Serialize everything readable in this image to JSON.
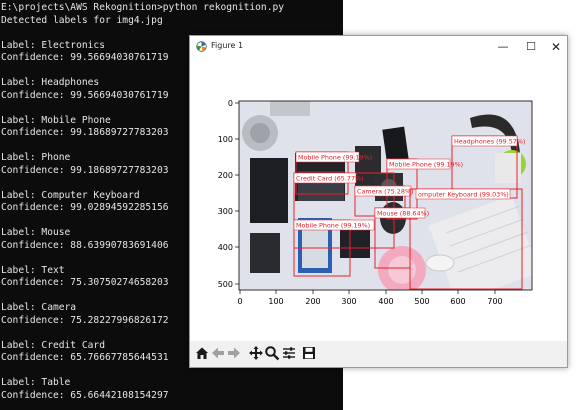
{
  "console": {
    "lines": [
      "E:\\projects\\AWS Rekognition>python rekognition.py",
      "Detected labels for img4.jpg",
      "",
      "Label: Electronics",
      "Confidence: 99.56694030761719",
      "",
      "Label: Headphones",
      "Confidence: 99.56694030761719",
      "",
      "Label: Mobile Phone",
      "Confidence: 99.18689727783203",
      "",
      "Label: Phone",
      "Confidence: 99.18689727783203",
      "",
      "Label: Computer Keyboard",
      "Confidence: 99.02894592285156",
      "",
      "Label: Mouse",
      "Confidence: 88.63990783691406",
      "",
      "Label: Text",
      "Confidence: 75.30750274658203",
      "",
      "Label: Camera",
      "Confidence: 75.28227996826172",
      "",
      "Label: Credit Card",
      "Confidence: 65.76667785644531",
      "",
      "Label: Table",
      "Confidence: 65.66442108154297"
    ]
  },
  "figure": {
    "title": "Figure 1",
    "window_buttons": {
      "minimize": "—",
      "maximize": "☐",
      "close": "✕"
    },
    "xticks": [
      "0",
      "100",
      "200",
      "300",
      "400",
      "500",
      "600",
      "700"
    ],
    "yticks": [
      "0",
      "100",
      "200",
      "300",
      "400",
      "500"
    ],
    "box_color": "#e8202a",
    "detections": [
      {
        "label": "Headphones (99.57%)"
      },
      {
        "label": "Mobile Phone (99.19%)"
      },
      {
        "label": "Mobile Phone (99.19%)"
      },
      {
        "label": "Credit Card (65.77%)"
      },
      {
        "label": "Camera (75.28%)"
      },
      {
        "label": "omputer Keyboard (99.03%)"
      },
      {
        "label": "Mouse (88.64%)"
      },
      {
        "label": "Mobile Phone (99.19%)"
      }
    ],
    "toolbar": [
      "home-icon",
      "back-arrow-icon",
      "forward-arrow-icon",
      "pan-icon",
      "zoom-icon",
      "configure-subplots-icon",
      "save-icon"
    ]
  }
}
